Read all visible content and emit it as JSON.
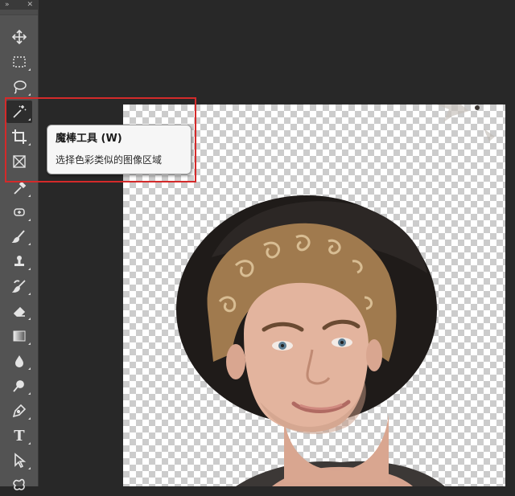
{
  "toolbar": {
    "tools": [
      {
        "name": "move-tool",
        "icon": "move-icon"
      },
      {
        "name": "rectangular-marquee-tool",
        "icon": "marquee-icon"
      },
      {
        "name": "lasso-tool",
        "icon": "lasso-icon"
      },
      {
        "name": "magic-wand-tool",
        "icon": "magic-wand-icon",
        "active": true
      },
      {
        "name": "crop-tool",
        "icon": "crop-icon"
      },
      {
        "name": "frame-tool",
        "icon": "frame-icon"
      },
      {
        "name": "eyedropper-tool",
        "icon": "eyedropper-icon"
      },
      {
        "name": "spot-healing-tool",
        "icon": "healing-icon"
      },
      {
        "name": "brush-tool",
        "icon": "brush-icon"
      },
      {
        "name": "clone-stamp-tool",
        "icon": "stamp-icon"
      },
      {
        "name": "history-brush-tool",
        "icon": "history-brush-icon"
      },
      {
        "name": "eraser-tool",
        "icon": "eraser-icon"
      },
      {
        "name": "gradient-tool",
        "icon": "gradient-icon"
      },
      {
        "name": "blur-tool",
        "icon": "drop-icon"
      },
      {
        "name": "dodge-tool",
        "icon": "dodge-icon"
      },
      {
        "name": "pen-tool",
        "icon": "pen-icon"
      },
      {
        "name": "type-tool",
        "icon": "type-icon",
        "glyph": "T"
      },
      {
        "name": "path-selection-tool",
        "icon": "arrow-icon"
      },
      {
        "name": "custom-shape-tool",
        "icon": "shape-icon"
      }
    ]
  },
  "tooltip": {
    "title": "魔棒工具 (W)",
    "description": "选择色彩类似的图像区域"
  },
  "colors": {
    "panel_bg": "#535353",
    "workspace_bg": "#282828",
    "highlight": "#d42a2a",
    "tooltip_bg": "#f6f6f6"
  }
}
